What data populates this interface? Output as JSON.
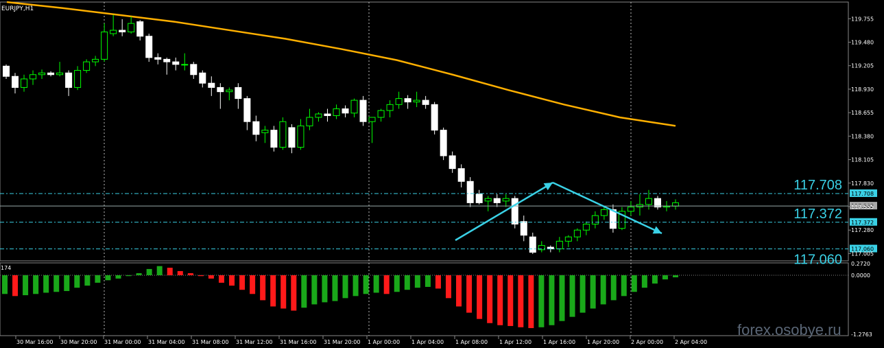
{
  "symbol": "EURJPY,H1",
  "watermark": "forex.osobye.ru",
  "colors": {
    "bull": "#00ff00",
    "bear": "#ffffff",
    "ma": "#ffb000",
    "level": "#3ad1e6",
    "up_hist": "#1aa81a",
    "down_hist": "#ff1a1a"
  },
  "levels": [
    {
      "price": 117.708,
      "label": "117.708"
    },
    {
      "price": 117.372,
      "label": "117.372"
    },
    {
      "price": 117.06,
      "label": "117.060"
    }
  ],
  "current_price": {
    "price": 117.562,
    "label": "117.562"
  },
  "macd_labels": {
    "top": "0.2720",
    "zero": "0.0000",
    "bottom": "-1.2763",
    "left": "174"
  },
  "chart_data": [
    {
      "type": "candlestick",
      "title": "EURJPY,H1",
      "ylim": [
        116.92,
        119.95
      ],
      "yticks": [
        "119.755",
        "119.480",
        "119.205",
        "118.930",
        "118.655",
        "118.380",
        "118.105",
        "117.830",
        "117.555",
        "117.280",
        "117.005"
      ],
      "xticks": [
        "30 Mar 16:00",
        "30 Mar 20:00",
        "31 Mar 00:00",
        "31 Mar 04:00",
        "31 Mar 08:00",
        "31 Mar 12:00",
        "31 Mar 16:00",
        "31 Mar 20:00",
        "1 Apr 00:00",
        "1 Apr 04:00",
        "1 Apr 08:00",
        "1 Apr 12:00",
        "1 Apr 16:00",
        "1 Apr 20:00",
        "2 Apr 00:00",
        "2 Apr 04:00"
      ],
      "candles": [
        [
          119.2,
          119.22,
          119.05,
          119.08
        ],
        [
          119.08,
          119.12,
          118.88,
          118.95
        ],
        [
          118.95,
          119.1,
          118.9,
          119.05
        ],
        [
          119.05,
          119.15,
          118.98,
          119.1
        ],
        [
          119.1,
          119.16,
          119.05,
          119.12
        ],
        [
          119.12,
          119.14,
          119.08,
          119.1
        ],
        [
          119.1,
          119.25,
          119.08,
          119.12
        ],
        [
          119.12,
          119.15,
          118.85,
          118.95
        ],
        [
          118.95,
          119.2,
          118.92,
          119.15
        ],
        [
          119.15,
          119.28,
          119.12,
          119.25
        ],
        [
          119.25,
          119.32,
          119.2,
          119.28
        ],
        [
          119.28,
          119.7,
          119.25,
          119.6
        ],
        [
          119.58,
          119.8,
          119.55,
          119.62
        ],
        [
          119.62,
          119.75,
          119.55,
          119.6
        ],
        [
          119.6,
          119.78,
          119.58,
          119.7
        ],
        [
          119.72,
          119.74,
          119.5,
          119.55
        ],
        [
          119.55,
          119.58,
          119.25,
          119.3
        ],
        [
          119.3,
          119.35,
          119.22,
          119.28
        ],
        [
          119.28,
          119.3,
          119.1,
          119.25
        ],
        [
          119.25,
          119.3,
          119.15,
          119.22
        ],
        [
          119.22,
          119.35,
          119.15,
          119.22
        ],
        [
          119.22,
          119.25,
          119.05,
          119.1
        ],
        [
          119.12,
          119.15,
          118.95,
          119.0
        ],
        [
          119.0,
          119.08,
          118.85,
          118.95
        ],
        [
          118.95,
          119.0,
          118.7,
          118.9
        ],
        [
          118.9,
          118.95,
          118.8,
          118.92
        ],
        [
          118.95,
          119.0,
          118.7,
          118.82
        ],
        [
          118.82,
          118.85,
          118.45,
          118.55
        ],
        [
          118.55,
          118.62,
          118.32,
          118.4
        ],
        [
          118.42,
          118.5,
          118.3,
          118.45
        ],
        [
          118.45,
          118.5,
          118.2,
          118.25
        ],
        [
          118.25,
          118.6,
          118.22,
          118.55
        ],
        [
          118.48,
          118.52,
          118.18,
          118.25
        ],
        [
          118.25,
          118.58,
          118.22,
          118.5
        ],
        [
          118.5,
          118.7,
          118.45,
          118.6
        ],
        [
          118.6,
          118.66,
          118.55,
          118.64
        ],
        [
          118.64,
          118.7,
          118.55,
          118.62
        ],
        [
          118.62,
          118.75,
          118.58,
          118.7
        ],
        [
          118.7,
          118.74,
          118.6,
          118.65
        ],
        [
          118.65,
          118.82,
          118.6,
          118.8
        ],
        [
          118.8,
          118.85,
          118.5,
          118.55
        ],
        [
          118.55,
          118.6,
          118.3,
          118.6
        ],
        [
          118.6,
          118.7,
          118.55,
          118.68
        ],
        [
          118.68,
          118.8,
          118.6,
          118.75
        ],
        [
          118.75,
          118.9,
          118.7,
          118.82
        ],
        [
          118.82,
          118.86,
          118.7,
          118.78
        ],
        [
          118.78,
          118.9,
          118.72,
          118.8
        ],
        [
          118.8,
          118.85,
          118.7,
          118.75
        ],
        [
          118.75,
          118.78,
          118.4,
          118.45
        ],
        [
          118.45,
          118.48,
          118.1,
          118.15
        ],
        [
          118.15,
          118.2,
          117.95,
          118.0
        ],
        [
          118.0,
          118.05,
          117.78,
          117.85
        ],
        [
          117.85,
          117.9,
          117.55,
          117.6
        ],
        [
          117.7,
          117.75,
          117.58,
          117.6
        ],
        [
          117.62,
          117.68,
          117.5,
          117.65
        ],
        [
          117.65,
          117.7,
          117.55,
          117.6
        ],
        [
          117.62,
          117.7,
          117.55,
          117.65
        ],
        [
          117.65,
          117.68,
          117.3,
          117.35
        ],
        [
          117.38,
          117.45,
          117.15,
          117.22
        ],
        [
          117.2,
          117.25,
          117.0,
          117.02
        ],
        [
          117.05,
          117.15,
          117.02,
          117.1
        ],
        [
          117.08,
          117.1,
          117.02,
          117.06
        ],
        [
          117.06,
          117.2,
          117.02,
          117.15
        ],
        [
          117.15,
          117.22,
          117.08,
          117.2
        ],
        [
          117.2,
          117.3,
          117.15,
          117.28
        ],
        [
          117.28,
          117.38,
          117.22,
          117.35
        ],
        [
          117.35,
          117.5,
          117.3,
          117.45
        ],
        [
          117.45,
          117.55,
          117.4,
          117.52
        ],
        [
          117.52,
          117.58,
          117.25,
          117.3
        ],
        [
          117.3,
          117.55,
          117.28,
          117.5
        ],
        [
          117.5,
          117.62,
          117.45,
          117.55
        ],
        [
          117.55,
          117.7,
          117.45,
          117.58
        ],
        [
          117.58,
          117.75,
          117.52,
          117.65
        ],
        [
          117.65,
          117.68,
          117.52,
          117.55
        ],
        [
          117.55,
          117.62,
          117.5,
          117.56
        ],
        [
          117.56,
          117.64,
          117.52,
          117.6
        ]
      ],
      "ma_line": [
        119.95,
        119.88,
        119.8,
        119.72,
        119.62,
        119.52,
        119.4,
        119.27,
        119.1,
        118.92,
        118.75,
        118.6,
        118.5
      ],
      "macd_hist": [
        -0.45,
        -0.5,
        -0.48,
        -0.45,
        -0.42,
        -0.4,
        -0.38,
        -0.3,
        -0.25,
        -0.18,
        -0.12,
        -0.08,
        -0.02,
        0.05,
        0.15,
        0.22,
        0.18,
        0.1,
        0.05,
        -0.02,
        -0.08,
        -0.18,
        -0.25,
        -0.35,
        -0.45,
        -0.6,
        -0.75,
        -0.8,
        -0.85,
        -0.78,
        -0.7,
        -0.65,
        -0.62,
        -0.55,
        -0.5,
        -0.45,
        -0.42,
        -0.45,
        -0.4,
        -0.35,
        -0.3,
        -0.28,
        -0.32,
        -0.55,
        -0.75,
        -0.9,
        -1.05,
        -1.15,
        -1.2,
        -1.22,
        -1.25,
        -1.27,
        -1.25,
        -1.2,
        -1.1,
        -1.0,
        -0.9,
        -0.8,
        -0.7,
        -0.6,
        -0.5,
        -0.4,
        -0.3,
        -0.2,
        -0.1,
        -0.05
      ]
    }
  ]
}
